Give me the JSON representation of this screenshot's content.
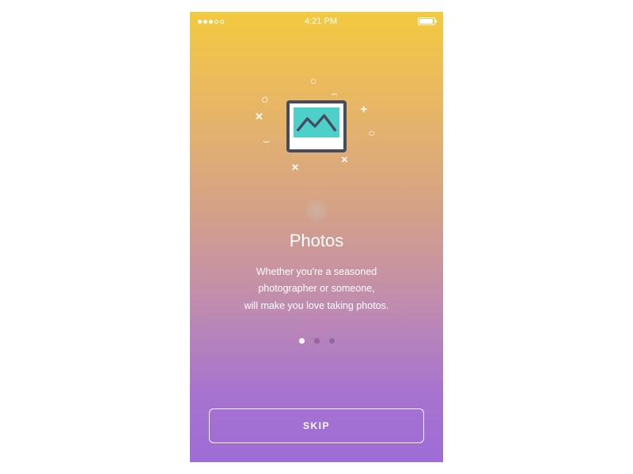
{
  "statusBar": {
    "time": "4:21 PM"
  },
  "onboarding": {
    "title": "Photos",
    "description_line1": "Whether you're a seasoned",
    "description_line2": "photographer or someone,",
    "description_line3": "will make you love taking photos."
  },
  "pagination": {
    "total": 3,
    "active": 0
  },
  "actions": {
    "skip_label": "SKIP"
  },
  "colors": {
    "gradient_top": "#f3ca3f",
    "gradient_bottom": "#9e6dd5",
    "icon_teal": "#4dd0c9",
    "icon_frame": "#4a4a5e"
  }
}
